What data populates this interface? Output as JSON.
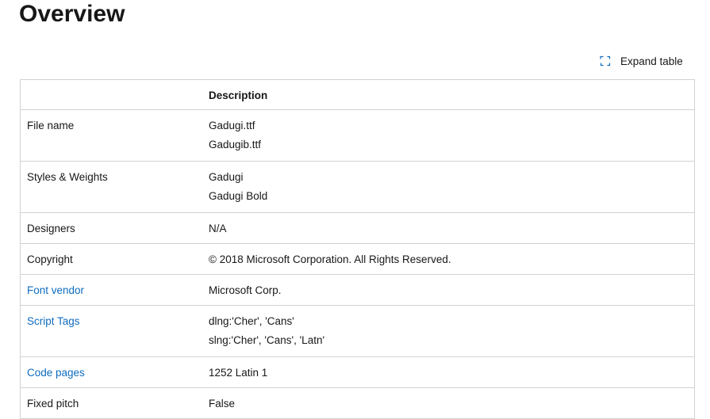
{
  "page": {
    "title": "Overview"
  },
  "toolbar": {
    "expand_label": "Expand table",
    "expand_icon": "expand-icon"
  },
  "table": {
    "header": {
      "col1": "",
      "col2": "Description"
    },
    "rows": [
      {
        "label": "File name",
        "is_link": false,
        "values": [
          "Gadugi.ttf",
          "Gadugib.ttf"
        ]
      },
      {
        "label": "Styles & Weights",
        "is_link": false,
        "values": [
          "Gadugi",
          "Gadugi Bold"
        ]
      },
      {
        "label": "Designers",
        "is_link": false,
        "values": [
          "N/A"
        ]
      },
      {
        "label": "Copyright",
        "is_link": false,
        "values": [
          "© 2018 Microsoft Corporation. All Rights Reserved."
        ]
      },
      {
        "label": "Font vendor",
        "is_link": true,
        "values": [
          "Microsoft Corp."
        ]
      },
      {
        "label": "Script Tags",
        "is_link": true,
        "values": [
          "dlng:'Cher', 'Cans'",
          "slng:'Cher', 'Cans', 'Latn'"
        ]
      },
      {
        "label": "Code pages",
        "is_link": true,
        "values": [
          "1252 Latin 1"
        ]
      },
      {
        "label": "Fixed pitch",
        "is_link": false,
        "values": [
          "False"
        ]
      }
    ]
  },
  "colors": {
    "link": "#0f6cbd",
    "border": "#d2d2d2",
    "text": "#171717"
  }
}
